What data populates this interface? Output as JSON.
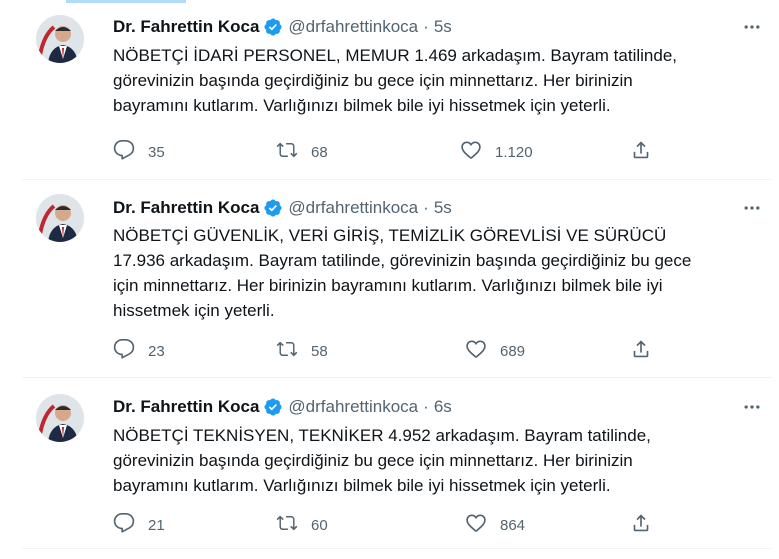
{
  "author": {
    "name": "Dr. Fahrettin Koca",
    "handle": "@drfahrettinkoca",
    "separator": "·"
  },
  "tweets": [
    {
      "time": "5s",
      "text": "NÖBETÇİ İDARİ PERSONEL, MEMUR 1.469 arkadaşım. Bayram tatilinde,\ngörevinizin başında geçirdiğiniz bu gece için minnettarız. Her birinizin\nbayramını kutlarım. Varlığınızı bilmek bile iyi hissetmek için yeterli.",
      "replies": "35",
      "retweets": "68",
      "likes": "1.120"
    },
    {
      "time": "5s",
      "text": "NÖBETÇİ GÜVENLİK, VERİ GİRİŞ, TEMİZLİK GÖREVLİSİ VE SÜRÜCÜ\n17.936 arkadaşım. Bayram tatilinde, görevinizin başında geçirdiğiniz bu gece\niçin minnettarız. Her birinizin bayramını kutlarım. Varlığınızı bilmek bile iyi\nhissetmek için yeterli.",
      "replies": "23",
      "retweets": "58",
      "likes": "689"
    },
    {
      "time": "6s",
      "text": "NÖBETÇİ TEKNİSYEN, TEKNİKER 4.952 arkadaşım. Bayram tatilinde,\ngörevinizin başında geçirdiğiniz bu gece için minnettarız. Her birinizin\nbayramını kutlarım. Varlığınızı bilmek bile iyi hissetmek için yeterli.",
      "replies": "21",
      "retweets": "60",
      "likes": "864"
    }
  ],
  "icons": {
    "verified": "verified-badge-icon",
    "more": "more-icon",
    "reply": "reply-icon",
    "retweet": "retweet-icon",
    "like": "like-icon",
    "share": "share-icon"
  },
  "colors": {
    "text": "#0f1419",
    "secondary": "#536471",
    "verified": "#1d9bf0",
    "divider": "#eff3f4"
  }
}
